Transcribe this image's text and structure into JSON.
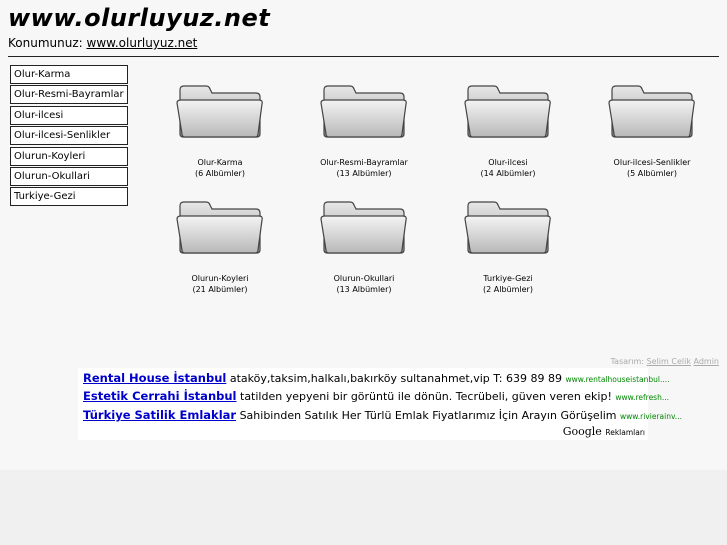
{
  "header": {
    "title": "www.olurluyuz.net",
    "location_label": "Konumunuz:",
    "location_link": "www.olurluyuz.net"
  },
  "sidebar": {
    "items": [
      {
        "label": "Olur-Karma"
      },
      {
        "label": "Olur-Resmi-Bayramlar"
      },
      {
        "label": "Olur-ilcesi"
      },
      {
        "label": "Olur-ilcesi-Senlikler"
      },
      {
        "label": "Olurun-Koyleri"
      },
      {
        "label": "Olurun-Okullari"
      },
      {
        "label": "Turkiye-Gezi"
      }
    ]
  },
  "albums": [
    {
      "name": "Olur-Karma",
      "count": "(6 Albümler)"
    },
    {
      "name": "Olur-Resmi-Bayramlar",
      "count": "(13 Albümler)"
    },
    {
      "name": "Olur-ilcesi",
      "count": "(14 Albümler)"
    },
    {
      "name": "Olur-ilcesi-Senlikler",
      "count": "(5 Albümler)"
    },
    {
      "name": "Olurun-Koyleri",
      "count": "(21 Albümler)"
    },
    {
      "name": "Olurun-Okullari",
      "count": "(13 Albümler)"
    },
    {
      "name": "Turkiye-Gezi",
      "count": "(2 Albümler)"
    }
  ],
  "credits": {
    "label": "Tasarım:",
    "designer": "Selim Celik",
    "admin": "Admin"
  },
  "ads": {
    "items": [
      {
        "title": "Rental House İstanbul",
        "text": "ataköy,taksim,halkalı,bakırköy sultanahmet,vip T: 639 89 89",
        "url": "www.rentalhouseistanbul...."
      },
      {
        "title": "Estetik Cerrahi İstanbul",
        "text": "tatilden yepyeni bir görüntü ile dönün. Tecrübeli, güven veren ekip!",
        "url": "www.refresh..."
      },
      {
        "title": "Türkiye Satilik Emlaklar",
        "text": "Sahibinden Satılık Her Türlü Emlak Fiyatlarımız İçin Arayın Görüşelim",
        "url": "www.rivierainv..."
      }
    ],
    "google_label": "Google",
    "reklam_label": "Reklamları"
  },
  "colors": {
    "ad_title": "#0000cc",
    "ad_url": "#008800",
    "credits": "#aaaaaa",
    "page_bg": "#f7f7f7"
  }
}
